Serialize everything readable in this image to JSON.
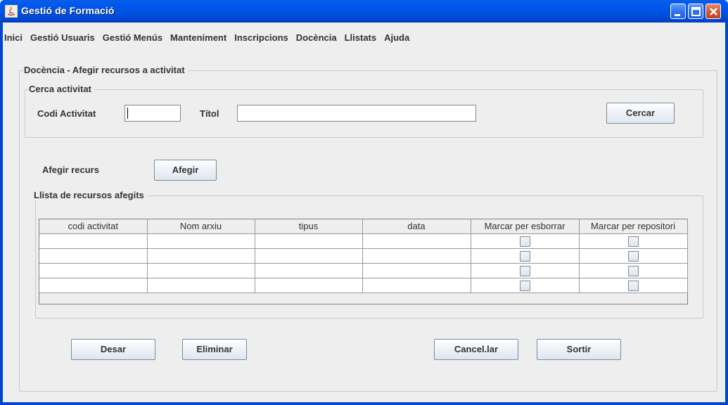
{
  "window": {
    "title": "Gestió de Formació"
  },
  "menu": [
    "Inici",
    "Gestió Usuaris",
    "Gestió Menús",
    "Manteniment",
    "Inscripcions",
    "Docència",
    "Llistats",
    "Ajuda"
  ],
  "panel": {
    "title": "Docència - Afegir recursos a activitat"
  },
  "search": {
    "group_title": "Cerca activitat",
    "codi_label": "Codi Activitat",
    "codi_value": "",
    "titol_label": "Títol",
    "titol_value": "",
    "search_button": "Cercar"
  },
  "add": {
    "label": "Afegir recurs",
    "button": "Afegir"
  },
  "resources": {
    "group_title": "Llista de recursos afegits",
    "columns": [
      "codi activitat",
      "Nom arxiu",
      "tipus",
      "data",
      "Marcar per esborrar",
      "Marcar per repositori"
    ],
    "rows": [
      [
        "",
        "",
        "",
        "",
        false,
        false
      ],
      [
        "",
        "",
        "",
        "",
        false,
        false
      ],
      [
        "",
        "",
        "",
        "",
        false,
        false
      ],
      [
        "",
        "",
        "",
        "",
        false,
        false
      ]
    ]
  },
  "actions": {
    "save": "Desar",
    "delete": "Eliminar",
    "cancel": "Cancel.lar",
    "exit": "Sortir"
  },
  "colors": {
    "titlebar": "#0053e0",
    "background": "#eeeeee",
    "close_button": "#d1552e"
  }
}
